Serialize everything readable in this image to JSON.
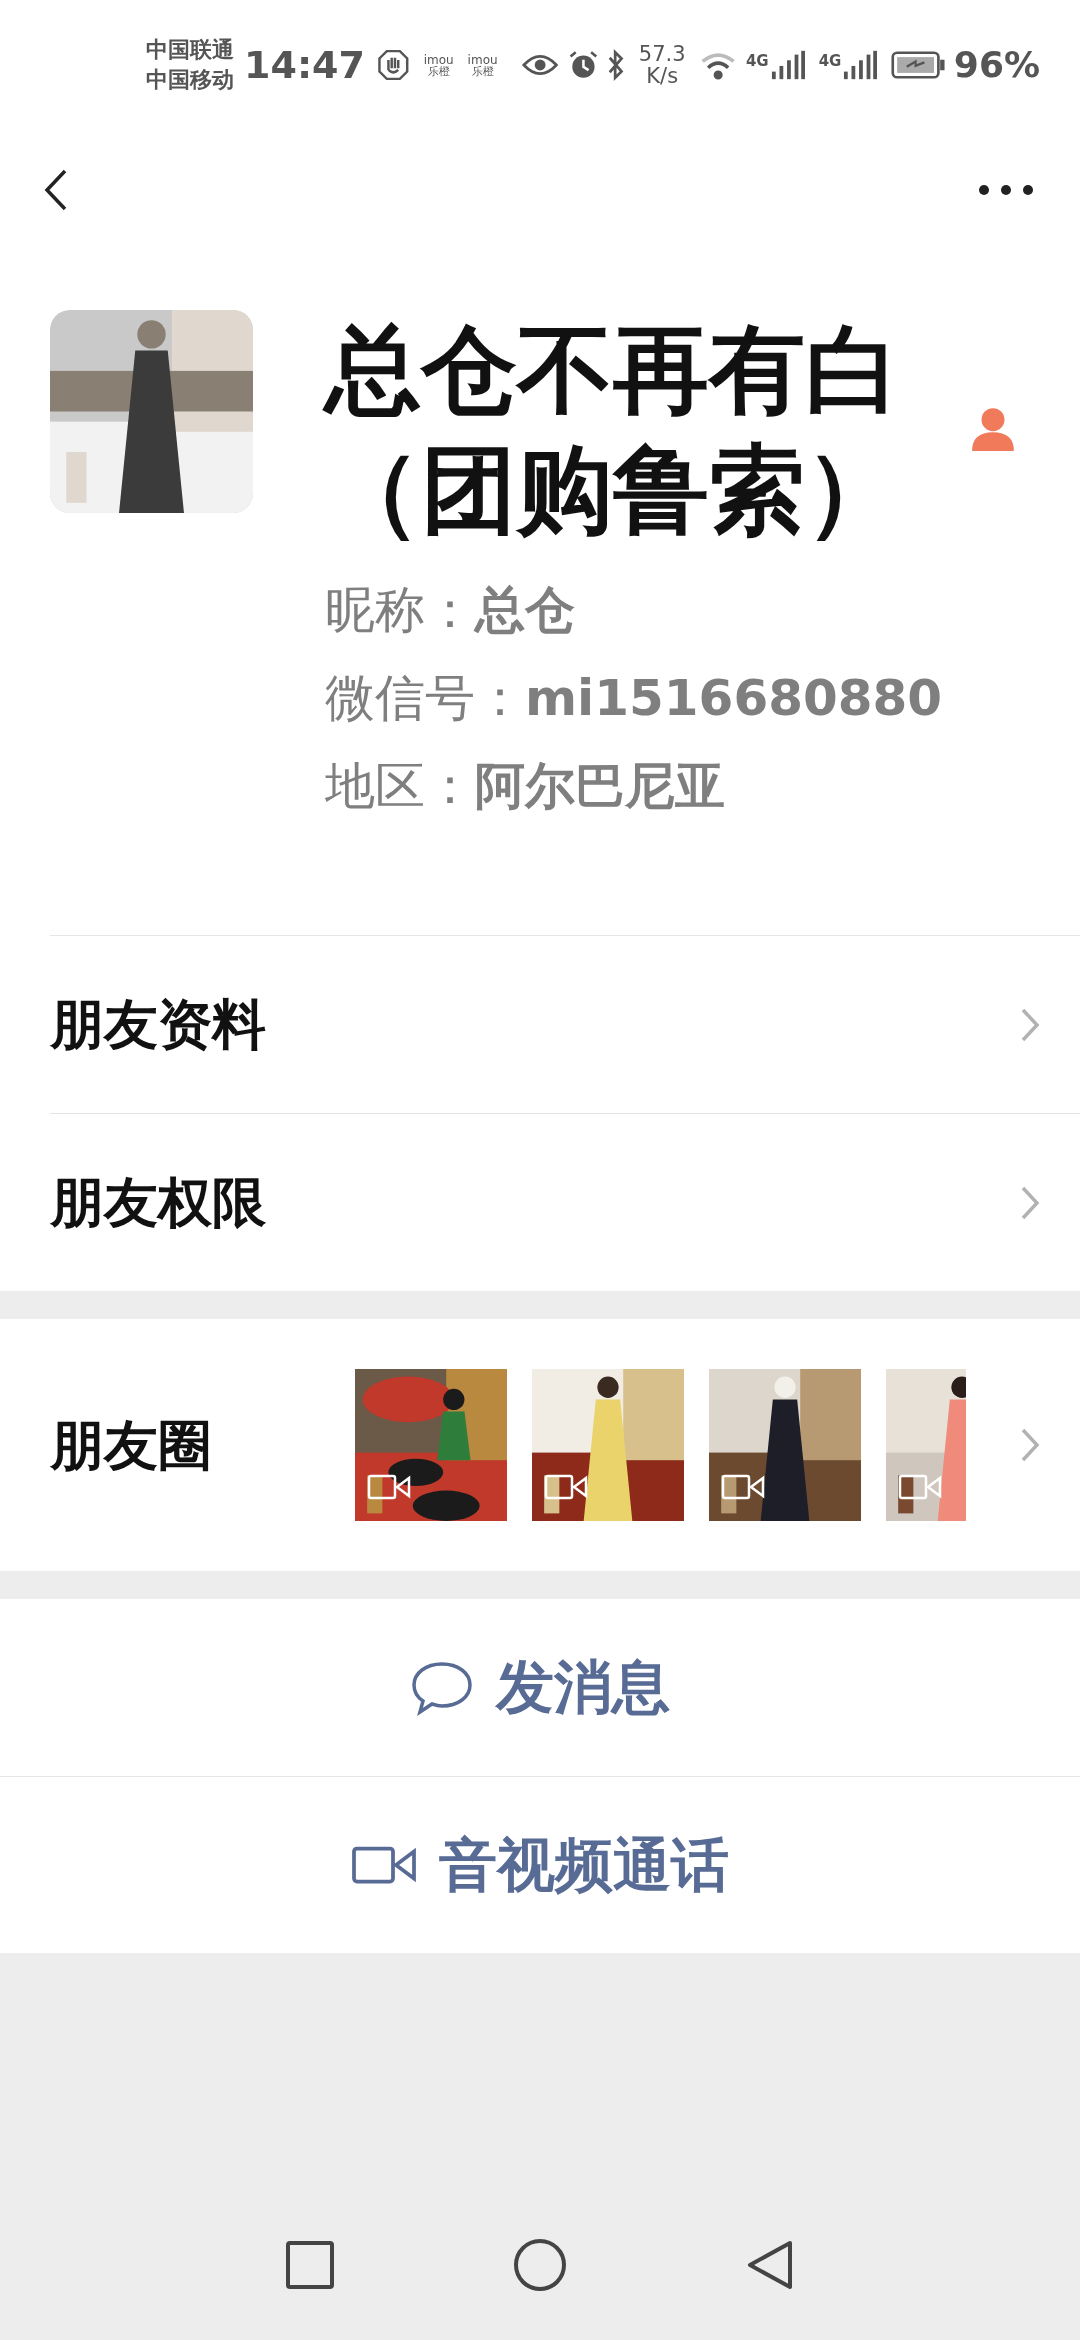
{
  "status_bar": {
    "carriers": [
      "中国联通",
      "中国移动"
    ],
    "time": "14:47",
    "app_badges": [
      {
        "brand": "imou",
        "sub": "乐橙"
      },
      {
        "brand": "imou",
        "sub": "乐橙"
      }
    ],
    "net_speed": {
      "value": "57.3",
      "unit": "K/s"
    },
    "signals": [
      "4G",
      "4G"
    ],
    "battery": "96%"
  },
  "profile": {
    "name": "总仓不再有白（团购鲁索）",
    "fields": [
      {
        "label": "昵称：",
        "value": "总仓"
      },
      {
        "label": "微信号：",
        "value": "mi1516680880"
      },
      {
        "label": "地区：",
        "value": "阿尔巴尼亚"
      }
    ]
  },
  "menu": [
    {
      "label": "朋友资料"
    },
    {
      "label": "朋友权限"
    }
  ],
  "moments": {
    "label": "朋友圈",
    "thumbnails": [
      {
        "kind": "picture",
        "video": true
      },
      {
        "kind": "picture",
        "video": true
      },
      {
        "kind": "picture",
        "video": true
      },
      {
        "kind": "picture",
        "video": true
      }
    ]
  },
  "actions": [
    {
      "kind": "message",
      "label": "发消息"
    },
    {
      "kind": "call",
      "label": "音视频通话"
    }
  ]
}
